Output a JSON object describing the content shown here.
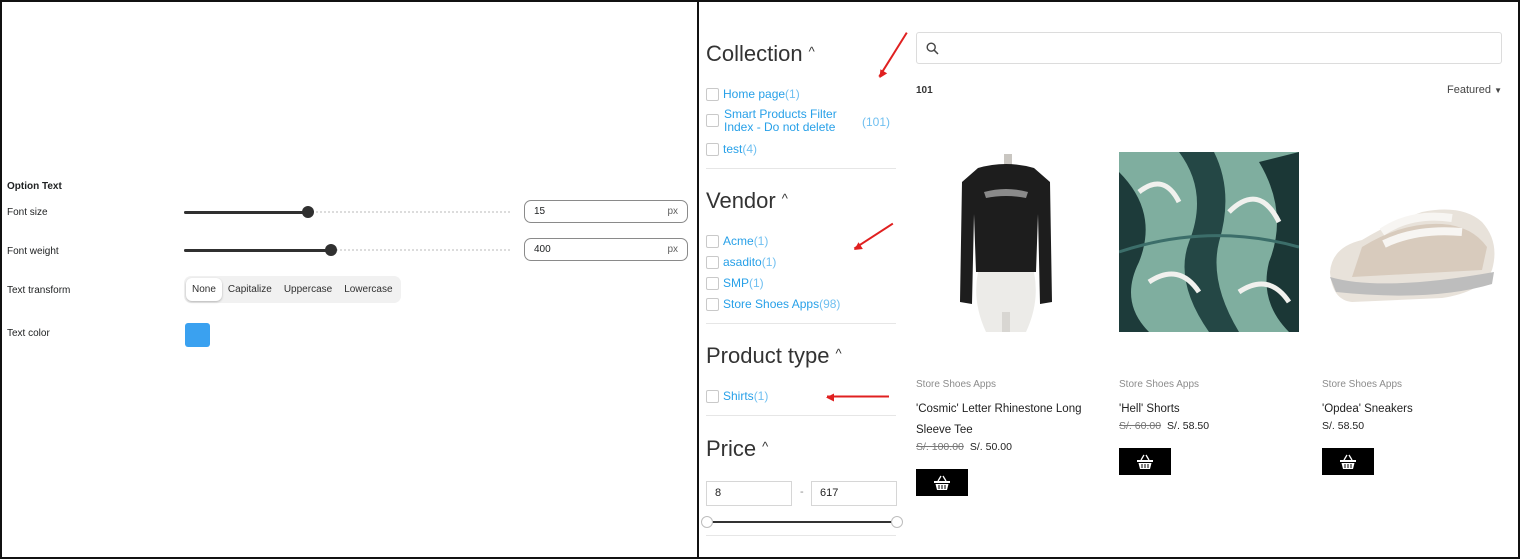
{
  "settings": {
    "section_title": "Option Text",
    "font_size": {
      "label": "Font size",
      "value": "15",
      "unit": "px",
      "slider_fraction": 0.38
    },
    "font_weight": {
      "label": "Font weight",
      "value": "400",
      "unit": "px",
      "slider_fraction": 0.45
    },
    "text_transform": {
      "label": "Text transform",
      "options": [
        "None",
        "Capitalize",
        "Uppercase",
        "Lowercase"
      ],
      "selected": "None"
    },
    "text_color": {
      "label": "Text color",
      "value": "#3aa1f0"
    }
  },
  "store": {
    "filters": {
      "collection": {
        "heading": "Collection",
        "items": [
          {
            "label": "Home page",
            "count": "(1)"
          },
          {
            "label": "Smart Products Filter Index - Do not delete",
            "count": "(101)"
          },
          {
            "label": "test",
            "count": "(4)"
          }
        ]
      },
      "vendor": {
        "heading": "Vendor",
        "items": [
          {
            "label": "Acme",
            "count": "(1)"
          },
          {
            "label": "asadito",
            "count": "(1)"
          },
          {
            "label": "SMP",
            "count": "(1)"
          },
          {
            "label": "Store Shoes Apps",
            "count": "(98)"
          }
        ]
      },
      "product_type": {
        "heading": "Product type",
        "items": [
          {
            "label": "Shirts",
            "count": "(1)"
          }
        ]
      },
      "price": {
        "heading": "Price",
        "min": "8",
        "max": "617",
        "separator": "-"
      }
    },
    "result_count": "101",
    "sort_label": "Featured",
    "products": [
      {
        "vendor": "Store Shoes Apps",
        "title": "'Cosmic' Letter Rhinestone Long Sleeve Tee",
        "old_price": "S/. 100.00",
        "price": "S/. 50.00"
      },
      {
        "vendor": "Store Shoes Apps",
        "title": "'Hell' Shorts",
        "old_price": "S/. 60.00",
        "price": "S/. 58.50"
      },
      {
        "vendor": "Store Shoes Apps",
        "title": "'Opdea' Sneakers",
        "old_price": "",
        "price": "S/. 58.50"
      }
    ],
    "accent_color": "#27a0e8",
    "annotation_color": "#e02020"
  }
}
